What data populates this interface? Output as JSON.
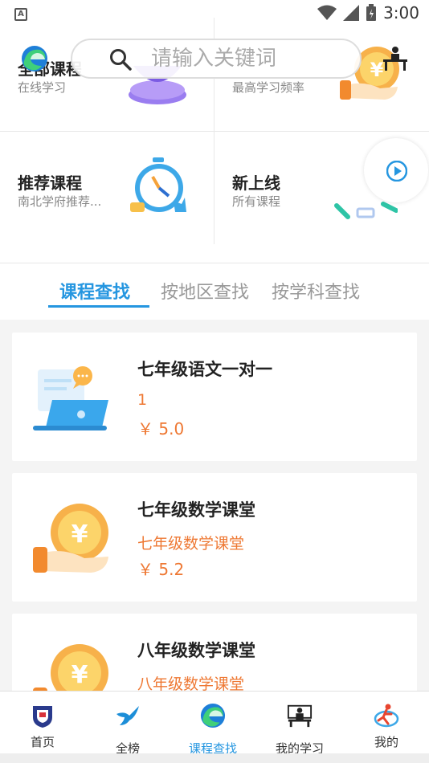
{
  "status_bar": {
    "time": "3:00",
    "left_icon": "A"
  },
  "categories": [
    {
      "title": "全部课程",
      "subtitle": "在线学习",
      "icon": "purple-pedestal-icon"
    },
    {
      "title": "",
      "subtitle": "最高学习频率",
      "icon": "coin-hand-icon"
    },
    {
      "title": "推荐课程",
      "subtitle": "南北学府推荐...",
      "icon": "stopwatch-icon"
    },
    {
      "title": "新上线",
      "subtitle": "所有课程",
      "icon": "play-icon"
    }
  ],
  "search": {
    "placeholder": "请输入关键词"
  },
  "tabs": [
    {
      "label": "课程查找",
      "active": true
    },
    {
      "label": "按地区查找",
      "active": false
    },
    {
      "label": "按学科查找",
      "active": false
    }
  ],
  "courses": [
    {
      "title": "七年级语文一对一",
      "desc": "1",
      "price": "￥ 5.0",
      "icon": "laptop-chat-icon"
    },
    {
      "title": "七年级数学课堂",
      "desc": "七年级数学课堂",
      "price": "￥ 5.2",
      "icon": "coin-hand-icon"
    },
    {
      "title": "八年级数学课堂",
      "desc": "八年级数学课堂",
      "price": "",
      "icon": "coin-hand-icon"
    }
  ],
  "nav": [
    {
      "label": "首页",
      "icon": "shield-icon",
      "active": false
    },
    {
      "label": "全榜",
      "icon": "bird-icon",
      "active": false
    },
    {
      "label": "课程查找",
      "icon": "edge-logo-icon",
      "active": true
    },
    {
      "label": "我的学习",
      "icon": "classroom-icon",
      "active": false
    },
    {
      "label": "我的",
      "icon": "runner-icon",
      "active": false
    }
  ],
  "colors": {
    "accent": "#2596e0",
    "price": "#ee7833",
    "list_bg": "#f4f4f4"
  }
}
